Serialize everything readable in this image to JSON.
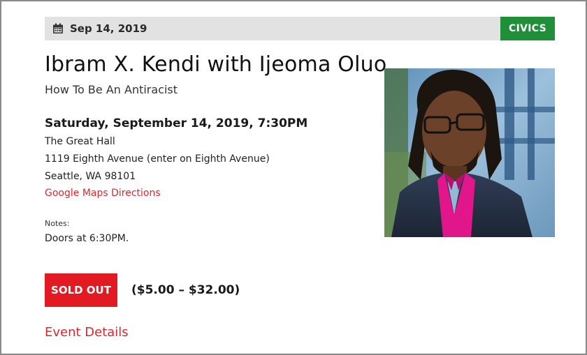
{
  "header": {
    "date": "Sep 14, 2019",
    "category": "CIVICS",
    "calendar_icon": "calendar-icon"
  },
  "event": {
    "title": "Ibram X. Kendi with Ijeoma Oluo",
    "subtitle": "How To Be An Antiracist",
    "datetime": "Saturday, September 14, 2019, 7:30PM",
    "venue": "The Great Hall",
    "address_line1": "1119 Eighth Avenue (enter on Eighth Avenue)",
    "address_line2": "Seattle, WA 98101",
    "maps_link": "Google Maps Directions",
    "notes_label": "Notes:",
    "notes": "Doors at 6:30PM."
  },
  "tickets": {
    "status_label": "SOLD OUT",
    "price_range": "($5.00 – $32.00)"
  },
  "details_link": "Event Details",
  "colors": {
    "accent_red": "#e21b23",
    "category_green": "#1f8f3a",
    "datebar_gray": "#e2e2e2"
  }
}
